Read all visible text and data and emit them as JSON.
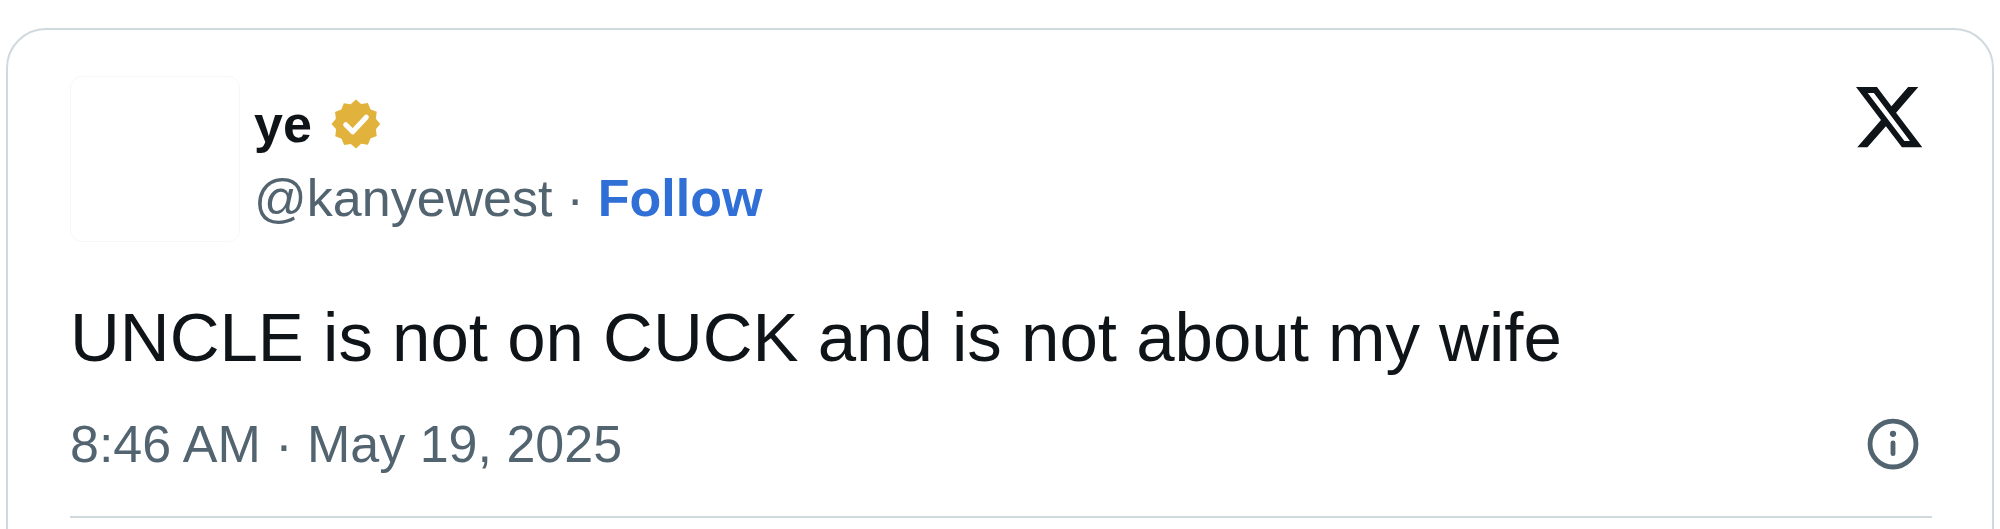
{
  "author": {
    "name": "ye",
    "verified": true,
    "handle": "@kanyewest",
    "separator": "·",
    "follow": "Follow"
  },
  "text": "UNCLE is not on CUCK and is not about my wife",
  "timestamp": "8:46 AM · May 19, 2025"
}
